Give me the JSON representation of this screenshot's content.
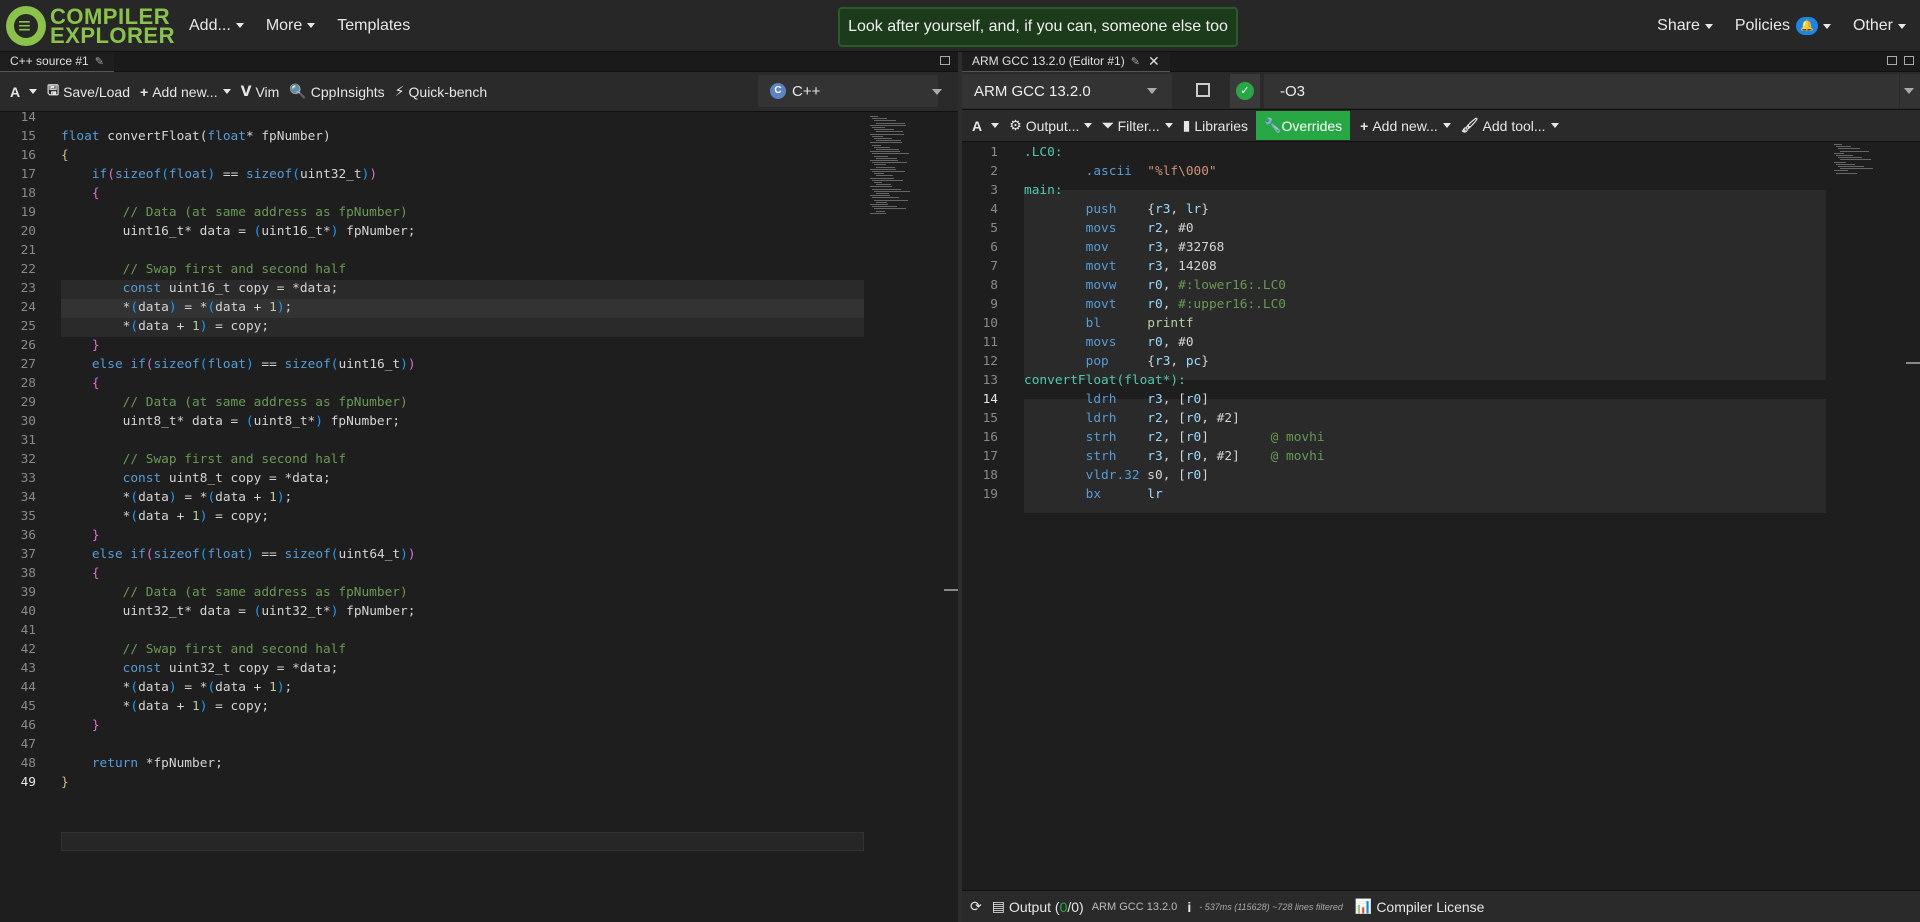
{
  "navbar": {
    "logo_line1": "COMPILER",
    "logo_line2": "EXPLORER",
    "add": "Add...",
    "more": "More",
    "templates": "Templates",
    "motd": "Look after yourself, and, if you can, someone else too",
    "share": "Share",
    "policies": "Policies",
    "policies_badge": "🔔",
    "other": "Other"
  },
  "source": {
    "tab_title": "C++ source #1",
    "toolbar": {
      "font": "A",
      "save_load": "Save/Load",
      "add_new": "Add new...",
      "vim": "Vim",
      "cppinsights": "CppInsights",
      "quickbench": "Quick-bench"
    },
    "language": "C++",
    "first_line_number": 14,
    "active_line": 49
  },
  "compiler": {
    "tab_title": "ARM GCC 13.2.0 (Editor #1)",
    "name": "ARM GCC 13.2.0",
    "options": "-O3",
    "toolbar": {
      "font": "A",
      "output": "Output...",
      "filter": "Filter...",
      "libraries": "Libraries",
      "overrides": "Overrides",
      "add_new": "Add new...",
      "add_tool": "Add tool..."
    },
    "active_line": 14,
    "status": {
      "output_label": "Output (",
      "output_ok": "0",
      "output_sep": "/",
      "output_err": "0",
      "output_close": ")",
      "compiler_name": "ARM GCC 13.2.0",
      "info_icon": "i",
      "timing": "- 537ms (115628) ~728 lines filtered",
      "license": "Compiler License"
    }
  },
  "colors": {
    "accent_green": "#28a745",
    "logo_green": "#8bc34a",
    "keyword": "#569cd6",
    "comment": "#6a9955"
  }
}
